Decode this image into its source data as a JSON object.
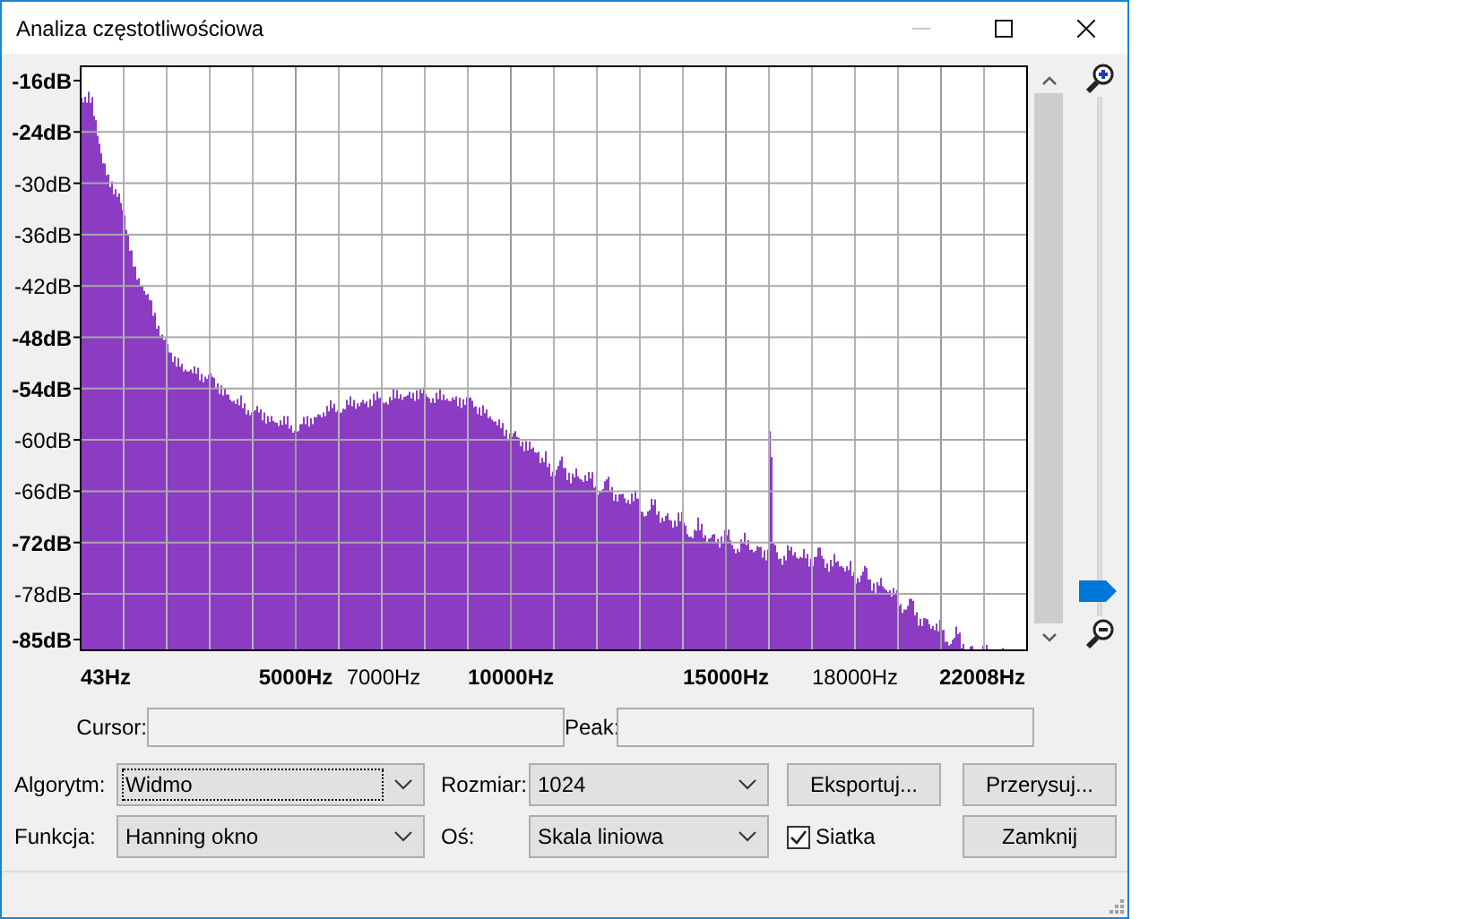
{
  "window": {
    "title": "Analiza częstotliwościowa",
    "buttons": [
      {
        "kind": "minimize",
        "disabled": true
      },
      {
        "kind": "maximize",
        "disabled": false
      },
      {
        "kind": "close",
        "disabled": false
      }
    ]
  },
  "plot": {
    "y_labels": [
      {
        "text": "-16dB",
        "bold": true
      },
      {
        "text": "-24dB",
        "bold": true
      },
      {
        "text": "-30dB",
        "bold": false
      },
      {
        "text": "-36dB",
        "bold": false
      },
      {
        "text": "-42dB",
        "bold": false
      },
      {
        "text": "-48dB",
        "bold": true
      },
      {
        "text": "-54dB",
        "bold": true
      },
      {
        "text": "-60dB",
        "bold": false
      },
      {
        "text": "-66dB",
        "bold": false
      },
      {
        "text": "-72dB",
        "bold": true
      },
      {
        "text": "-78dB",
        "bold": false
      },
      {
        "text": "-85dB",
        "bold": true
      }
    ],
    "x_labels": [
      {
        "text": "43Hz",
        "bold": true
      },
      {
        "text": "5000Hz",
        "bold": true
      },
      {
        "text": "7000Hz",
        "bold": false
      },
      {
        "text": "10000Hz",
        "bold": true
      },
      {
        "text": "15000Hz",
        "bold": true
      },
      {
        "text": "18000Hz",
        "bold": false
      },
      {
        "text": "22008Hz",
        "bold": true
      }
    ]
  },
  "zoom_slider": {
    "level": 0.05
  },
  "readouts": [
    {
      "label": "Cursor:"
    },
    {
      "label": "Peak:"
    }
  ],
  "algorithm": {
    "label": "Algorytm:",
    "value": "Widmo",
    "focused": true
  },
  "size": {
    "label": "Rozmiar:",
    "value": "1024",
    "focused": false
  },
  "function": {
    "label": "Funkcja:",
    "value": "Hanning okno",
    "focused": false
  },
  "axis": {
    "label": "Oś:",
    "value": "Skala liniowa",
    "focused": false
  },
  "grid_checkbox": {
    "label": "Siatka",
    "checked": true
  },
  "buttons": [
    {
      "label": "Eksportuj..."
    },
    {
      "label": "Przerysuj..."
    },
    {
      "label": "Zamknij"
    }
  ]
}
